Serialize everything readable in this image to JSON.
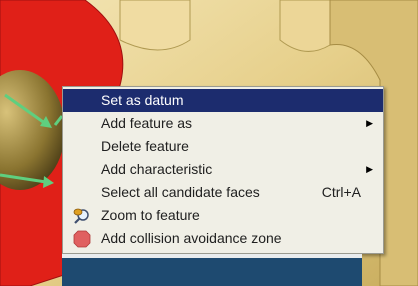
{
  "context_menu": {
    "items": [
      {
        "label": "Set as datum",
        "active": true,
        "submenu": false,
        "shortcut": "",
        "icon": ""
      },
      {
        "label": "Add feature as",
        "active": false,
        "submenu": true,
        "shortcut": "",
        "icon": ""
      },
      {
        "label": "Delete feature",
        "active": false,
        "submenu": false,
        "shortcut": "",
        "icon": ""
      },
      {
        "label": "Add characteristic",
        "active": false,
        "submenu": true,
        "shortcut": "",
        "icon": ""
      },
      {
        "label": "Select all candidate faces",
        "active": false,
        "submenu": false,
        "shortcut": "Ctrl+A",
        "icon": ""
      },
      {
        "label": "Zoom to feature",
        "active": false,
        "submenu": false,
        "shortcut": "",
        "icon": "zoom-magnifier-icon"
      },
      {
        "label": "Add collision avoidance zone",
        "active": false,
        "submenu": false,
        "shortcut": "",
        "icon": "collision-zone-icon"
      }
    ]
  },
  "colors": {
    "menu_highlight": "#1c2c6e",
    "part_red": "#e02018",
    "part_tan": "#e8d6a0",
    "vector_green": "#5fcf7f",
    "bottom_bar": "#1e4a70"
  }
}
